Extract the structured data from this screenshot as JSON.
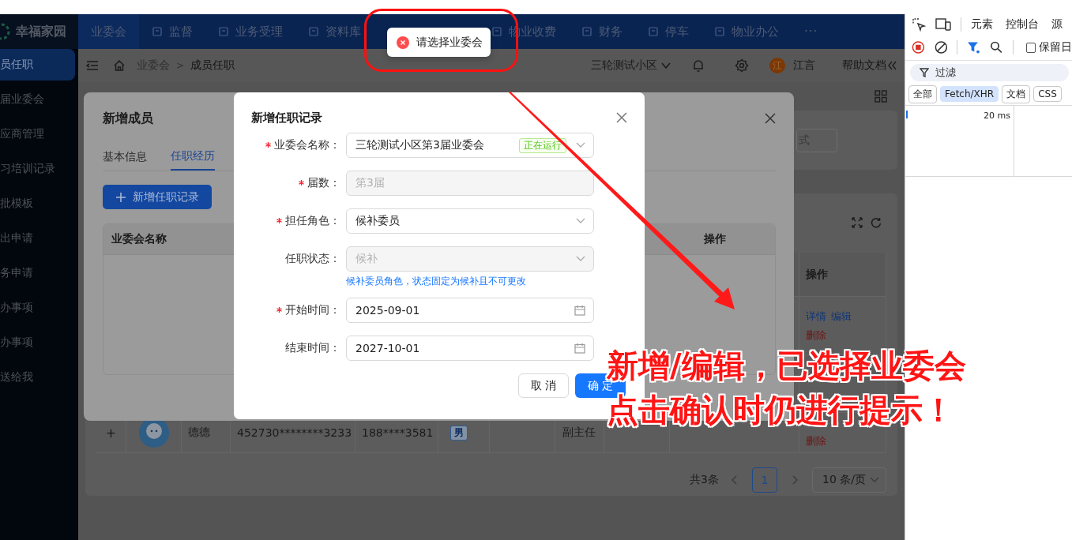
{
  "header": {
    "logo": "幸福家园",
    "nav": [
      {
        "label": "业委会",
        "selected": true
      },
      {
        "label": "监督",
        "selected": false
      },
      {
        "label": "业务受理",
        "selected": false
      },
      {
        "label": "资料库",
        "selected": false
      },
      {
        "label": "物业收费",
        "selected": false
      },
      {
        "label": "财务",
        "selected": false
      },
      {
        "label": "停车",
        "selected": false
      },
      {
        "label": "物业办公",
        "selected": false
      }
    ],
    "more": "···"
  },
  "sidebar": {
    "items": [
      {
        "label": "员任职",
        "selected": true
      },
      {
        "label": "届业委会",
        "selected": false
      },
      {
        "label": "应商管理",
        "selected": false
      },
      {
        "label": "习培训记录",
        "selected": false
      },
      {
        "label": "批模板",
        "selected": false
      },
      {
        "label": "出申请",
        "selected": false
      },
      {
        "label": "务申请",
        "selected": false
      },
      {
        "label": "办事项",
        "selected": false
      },
      {
        "label": "办事项",
        "selected": false
      },
      {
        "label": "送给我",
        "selected": false
      }
    ]
  },
  "breadcrumb": {
    "items": [
      "业委会",
      "成员任职"
    ],
    "separator": ">",
    "community": "三轮测试小区",
    "avatar": "江",
    "user": "江言",
    "help": "帮助文档"
  },
  "page": {
    "filter_field": "式",
    "table": {
      "action_column": "操作",
      "rows": [
        {
          "actions": [
            "详情",
            "编辑"
          ],
          "delete": "删除"
        },
        {
          "expand": "+",
          "name": "德德",
          "id_number": "452730********3233",
          "phone": "188****3581",
          "gender": "男",
          "role": "副主任",
          "delete": "删除"
        }
      ]
    },
    "pagination": {
      "total": "共3条",
      "pages": [
        {
          "label": "1",
          "selected": true
        }
      ],
      "page_size": "10 条/页"
    }
  },
  "member_dialog": {
    "title": "新增成员",
    "tabs": [
      {
        "label": "基本信息",
        "selected": false
      },
      {
        "label": "任职经历",
        "selected": true
      }
    ],
    "add_button": "新增任职记录",
    "columns": [
      "业委会名称",
      "操作"
    ]
  },
  "record_dialog": {
    "title": "新增任职记录",
    "fields": [
      {
        "label": "业委会名称：",
        "required": true,
        "kind": "select",
        "value": "三轮测试小区第3届业委会",
        "tag": "正在运行",
        "disabled": false
      },
      {
        "label": "届数：",
        "required": true,
        "kind": "input",
        "value": "第3届",
        "disabled": true
      },
      {
        "label": "担任角色：",
        "required": true,
        "kind": "select",
        "value": "候补委员",
        "disabled": false
      },
      {
        "label": "任职状态：",
        "required": false,
        "kind": "select",
        "value": "候补",
        "disabled": true,
        "hint": "候补委员角色，状态固定为候补且不可更改"
      },
      {
        "label": "开始时间：",
        "required": true,
        "kind": "date",
        "value": "2025-09-01",
        "disabled": false
      },
      {
        "label": "结束时间：",
        "required": false,
        "kind": "date",
        "value": "2027-10-01",
        "disabled": false
      }
    ],
    "buttons": [
      {
        "label": "取 消",
        "kind": "default"
      },
      {
        "label": "确 定",
        "kind": "primary"
      }
    ]
  },
  "toast": {
    "message": "请选择业委会"
  },
  "annotation": {
    "lines": [
      "新增/编辑，已选择业委会",
      "点击确认时仍进行提示！"
    ]
  },
  "devtools": {
    "tabs": [
      "元素",
      "控制台",
      "源"
    ],
    "preserve_log": {
      "label": "保留日",
      "checked": false
    },
    "filter_placeholder": "过滤",
    "types": [
      {
        "label": "全部",
        "selected": false
      },
      {
        "label": "Fetch/XHR",
        "selected": true
      },
      {
        "label": "文档",
        "selected": false
      },
      {
        "label": "CSS",
        "selected": false
      }
    ],
    "timeline_tick": "20 ms"
  }
}
